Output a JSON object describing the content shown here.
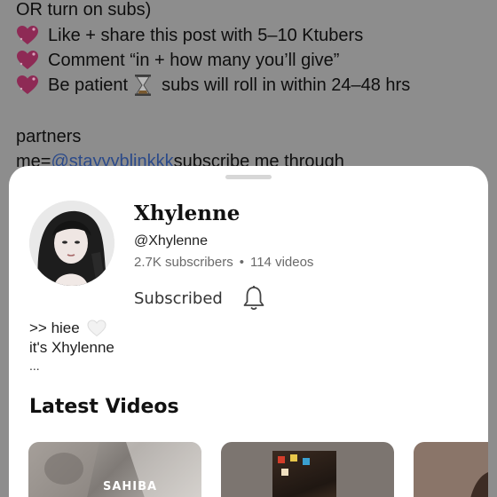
{
  "post": {
    "lines": [
      "OR turn on subs)",
      "Like + share this post with 5–10 Ktubers",
      "Comment “in + how many you’ll give”",
      "Be patient",
      "subs will roll in within 24–48 hrs",
      "partners",
      "me=",
      "@stayyyblinkkk",
      " subscribe me through"
    ]
  },
  "channel": {
    "name": "Xhylenne",
    "handle": "@Xhylenne",
    "subscribers": "2.7K subscribers",
    "separator": "•",
    "videos": "114 videos",
    "subscribed_label": "Subscribed",
    "description_line1": ">> hiee",
    "description_line2": "it's Xhylenne",
    "description_more": "..."
  },
  "sections": {
    "latest_videos": "Latest Videos"
  },
  "videos": [
    {
      "label": "SAHIBA"
    }
  ],
  "icons": {
    "heart": "sparkling-heart-icon",
    "hourglass": "hourglass-icon",
    "bell": "notification-bell-icon",
    "white_heart": "white-heart-icon"
  },
  "colors": {
    "overlay": "#8d8d8d",
    "sheet": "#ffffff",
    "mention": "#2b4a8a",
    "heart": "#c2185b"
  }
}
